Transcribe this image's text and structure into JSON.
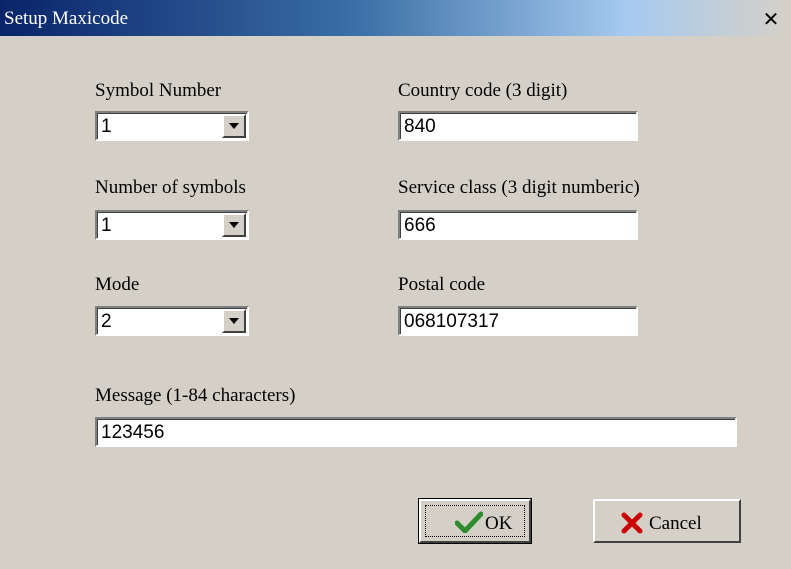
{
  "window": {
    "title": "Setup Maxicode",
    "close_glyph": "✕"
  },
  "fields": {
    "symbol_number": {
      "label": "Symbol Number",
      "value": "1"
    },
    "number_of_symbols": {
      "label": "Number of symbols",
      "value": "1"
    },
    "mode": {
      "label": "Mode",
      "value": "2"
    },
    "country_code": {
      "label": "Country code (3 digit)",
      "value": "840"
    },
    "service_class": {
      "label": "Service class (3 digit numberic)",
      "value": "666"
    },
    "postal_code": {
      "label": "Postal code",
      "value": "068107317"
    },
    "message": {
      "label": "Message (1-84 characters)",
      "value": "123456"
    }
  },
  "buttons": {
    "ok": {
      "label": "OK",
      "icon": "checkmark-icon",
      "icon_color": "#2e8b2e"
    },
    "cancel": {
      "label": "Cancel",
      "icon": "x-mark-icon",
      "icon_color": "#cc0000"
    }
  },
  "colors": {
    "dialog_bg": "#d4d0c8",
    "title_start": "#0a246a",
    "title_end": "#a6caf0"
  }
}
